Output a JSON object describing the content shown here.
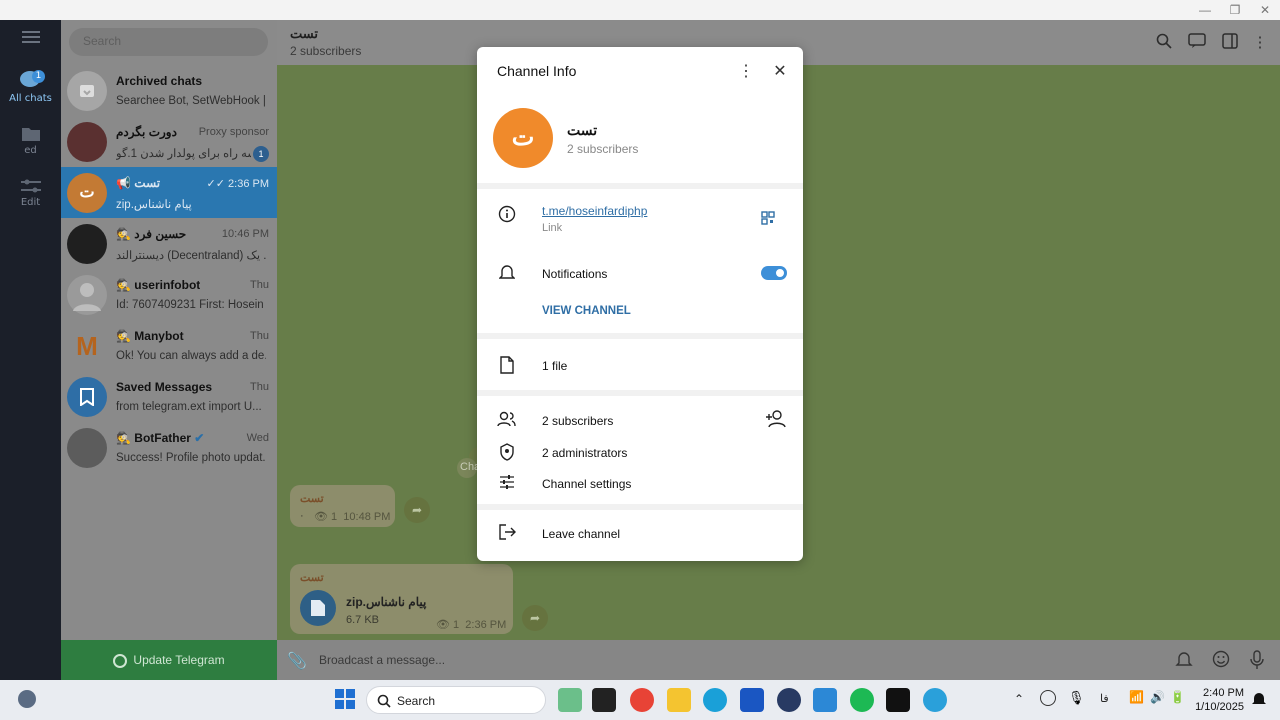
{
  "window": {
    "minimize": "—",
    "restore": "❐",
    "close": "✕"
  },
  "nav": {
    "items": [
      {
        "label": "All chats",
        "badge": "1"
      },
      {
        "label": "ed"
      },
      {
        "label": "Edit"
      }
    ]
  },
  "search": {
    "placeholder": "Search"
  },
  "chats": [
    {
      "name": "Archived chats",
      "preview": "Searchee Bot, SetWebHook | ...",
      "time": "",
      "avatar": "",
      "avatar_color": "#a6a6a6"
    },
    {
      "name": "دورت بگردم",
      "preview": "سه راه برای پولدار شدن 1.گو...",
      "time": "Proxy sponsor",
      "badge": "1",
      "avatar": "",
      "avatar_color": "#5a3030"
    },
    {
      "name": "📢 تست",
      "preview": "zip.پیام ناشناس",
      "time": "2:36 PM",
      "avatar": "ت",
      "avatar_color": "#c37a34",
      "read": "✓✓"
    },
    {
      "name": "🕵 حسین فرد",
      "preview": "دیسنترالند (Decentraland) یک ...",
      "time": "10:46 PM",
      "avatar": "",
      "avatar_color": "#1f1f1f"
    },
    {
      "name": "🕵 userinfobot",
      "preview": "Id: 7607409231 First: Hosein ...",
      "time": "Thu",
      "avatar": "",
      "avatar_color": "#9a9a9a"
    },
    {
      "name": "🕵 Manybot",
      "preview": "Ok! You can always add a de...",
      "time": "Thu",
      "avatar": "M",
      "avatar_color": "#8a8a8a"
    },
    {
      "name": "Saved Messages",
      "preview": "from telegram.ext import U...",
      "time": "Thu",
      "avatar": "",
      "avatar_color": "#2e6ea6"
    },
    {
      "name": "🕵 BotFather",
      "preview": "Success! Profile photo updat...",
      "time": "Wed",
      "avatar": "",
      "avatar_color": "#5c5c5c",
      "verified": "✔"
    }
  ],
  "update_label": "Update Telegram",
  "header": {
    "title": "تست",
    "subtitle": "2 subscribers"
  },
  "messages": [
    {
      "author": "تست",
      "text": "·",
      "views": "1",
      "time": "10:48 PM"
    },
    {
      "author": "تست",
      "file": "zip.پیام ناشناس",
      "size": "6.7 KB",
      "views": "1",
      "time": "2:36 PM"
    }
  ],
  "service_fragment": "Cha",
  "composer_placeholder": "Broadcast a message...",
  "modal": {
    "title": "Channel Info",
    "channel_name": "تست",
    "channel_initial": "ت",
    "subscribers": "2 subscribers",
    "link": "t.me/hoseinfardiphp",
    "link_label": "Link",
    "notifications_label": "Notifications",
    "notifications_on": true,
    "view_channel": "VIEW CHANNEL",
    "files": "1 file",
    "subscribers_row": "2 subscribers",
    "administrators": "2 administrators",
    "settings": "Channel settings",
    "leave": "Leave channel"
  },
  "taskbar": {
    "search": "Search",
    "time": "2:40 PM",
    "date": "1/10/2025",
    "lang": "فا"
  },
  "colors": {
    "accent": "#3d8fd8",
    "toggle": "#3d8fd8",
    "link": "#2f6ea5",
    "orange": "#f08a2b"
  }
}
